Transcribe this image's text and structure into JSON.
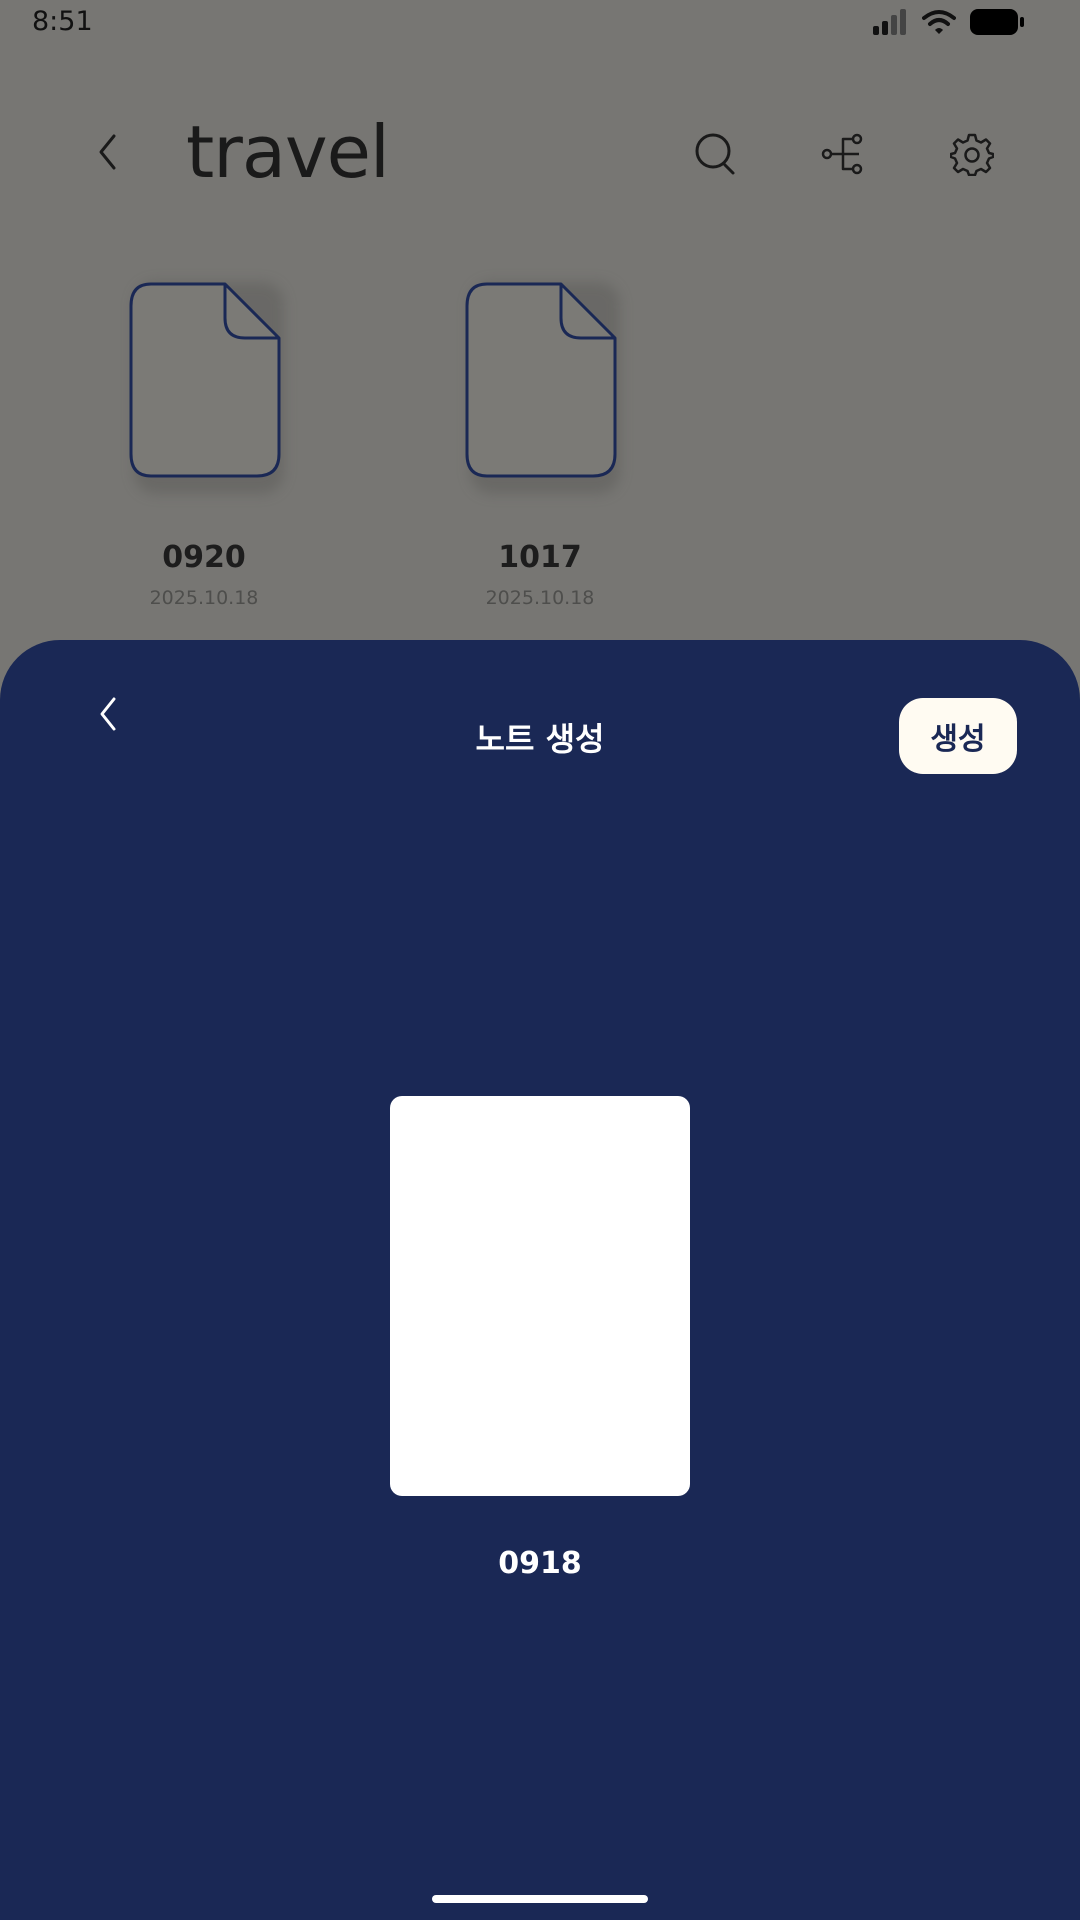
{
  "status_bar": {
    "time": "8:51"
  },
  "header": {
    "title": "travel",
    "icons": [
      "back-icon",
      "search-icon",
      "share-tree-icon",
      "gear-icon"
    ]
  },
  "files": [
    {
      "name": "0920",
      "date": "2025.10.18"
    },
    {
      "name": "1017",
      "date": "2025.10.18"
    }
  ],
  "sheet": {
    "title": "노트 생성",
    "create_label": "생성",
    "preview_name": "0918"
  },
  "colors": {
    "sheet_bg": "#1a2855",
    "overlay_bg": "#777673",
    "create_btn_bg": "#fffbf2",
    "file_outline": "#1a2855"
  }
}
